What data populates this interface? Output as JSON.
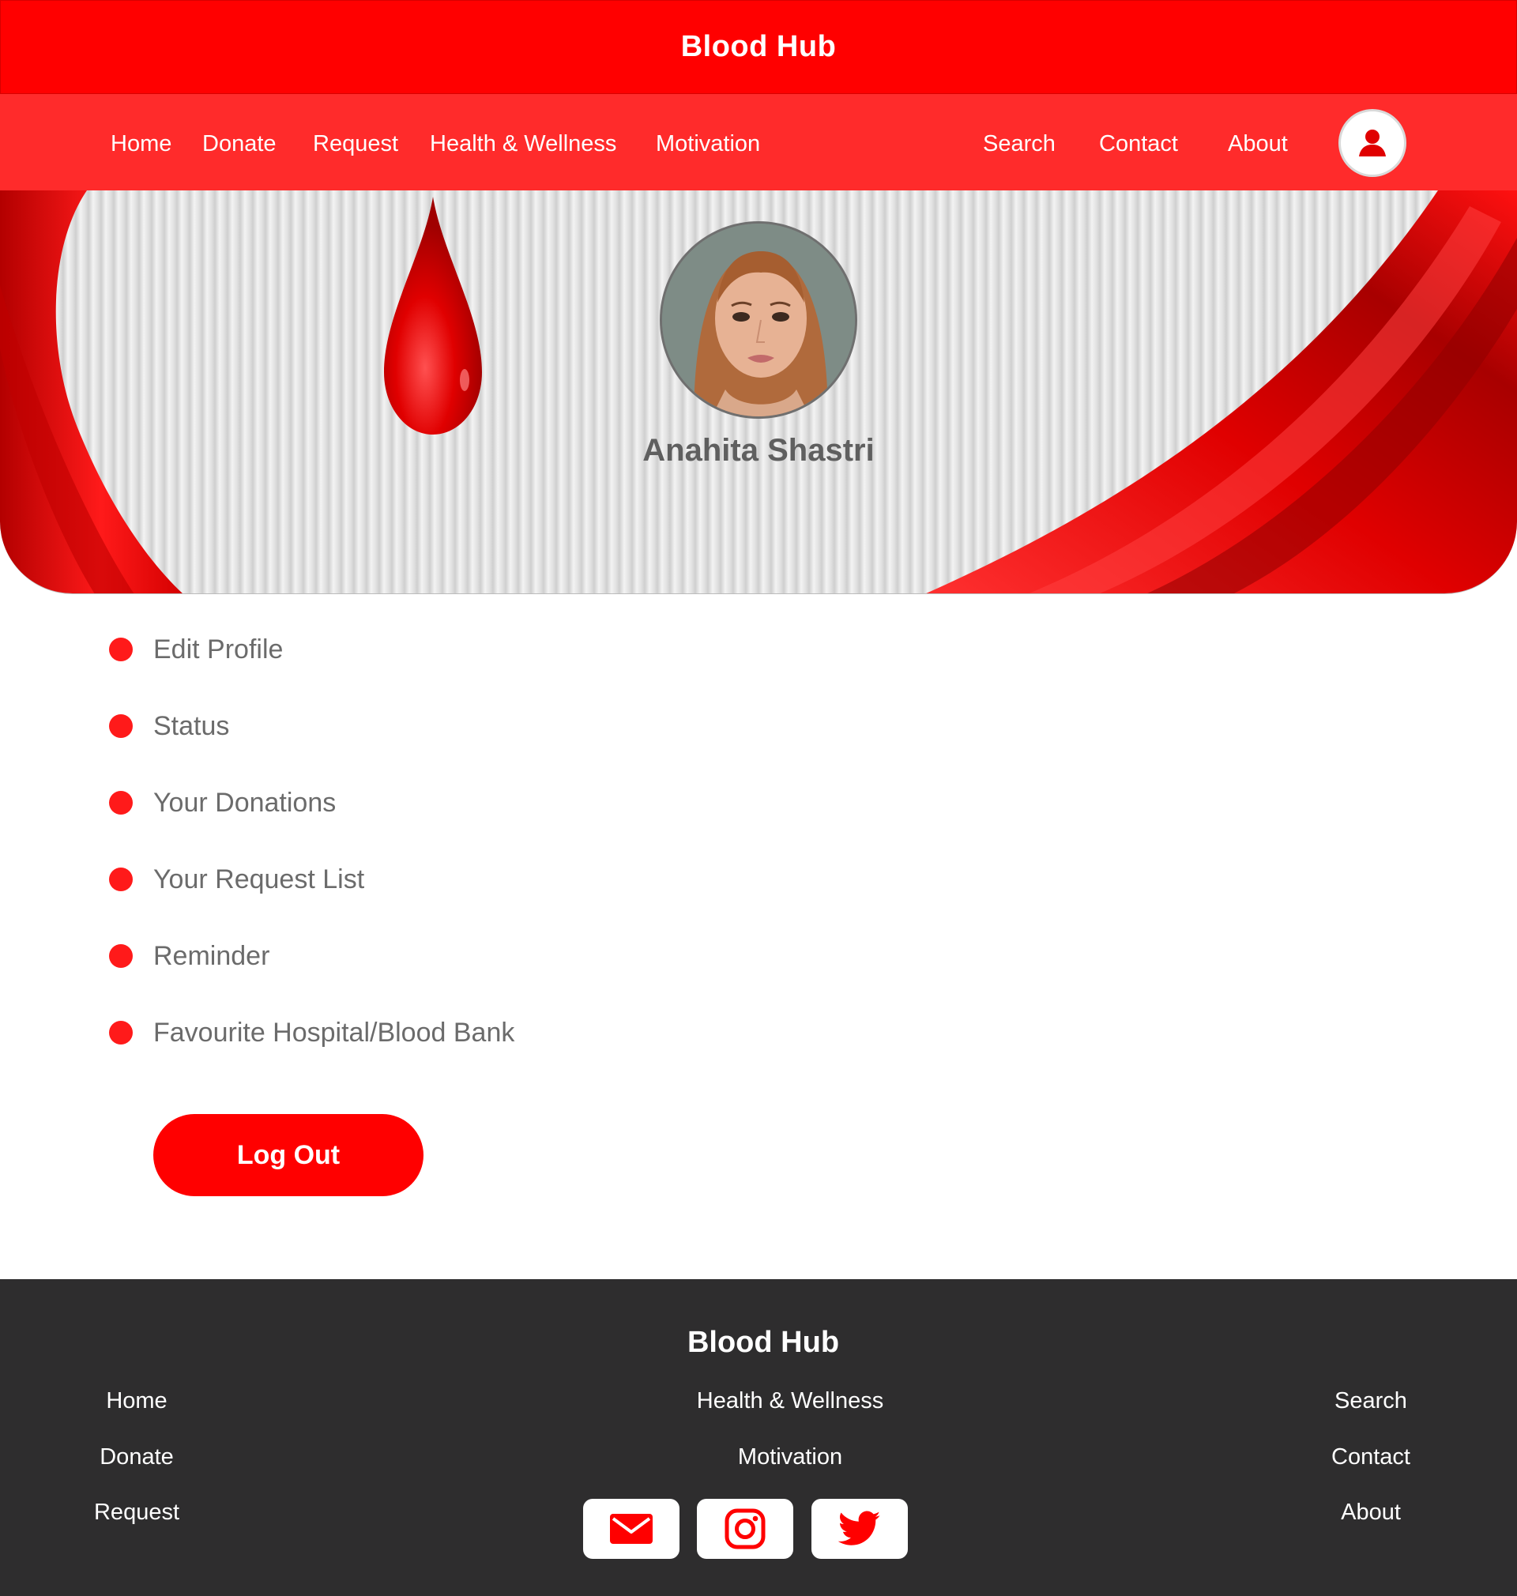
{
  "header": {
    "title": "Blood Hub"
  },
  "nav": {
    "left_links": [
      "Home",
      "Donate",
      "Request",
      "Health & Wellness",
      "Motivation"
    ],
    "right_links": [
      "Search",
      "Contact",
      "About"
    ],
    "profile_icon": "user-icon"
  },
  "profile": {
    "name": "Anahita Shastri",
    "avatar": "user-portrait"
  },
  "menu": {
    "items": [
      "Edit Profile",
      "Status",
      "Your Donations",
      "Your Request List",
      "Reminder",
      "Favourite Hospital/Blood Bank"
    ],
    "logout_label": "Log Out"
  },
  "footer": {
    "title": "Blood Hub",
    "left_links": [
      "Home",
      "Donate",
      "Request"
    ],
    "center_links": [
      "Health & Wellness",
      "Motivation"
    ],
    "right_links": [
      "Search",
      "Contact",
      "About"
    ],
    "social_icons": [
      "mail-icon",
      "instagram-icon",
      "twitter-icon"
    ]
  },
  "colors": {
    "brand_red": "#ff0000",
    "nav_red": "#ff2b2b",
    "footer_bg": "#2e2d2e",
    "text_gray": "#6b6b6b"
  }
}
